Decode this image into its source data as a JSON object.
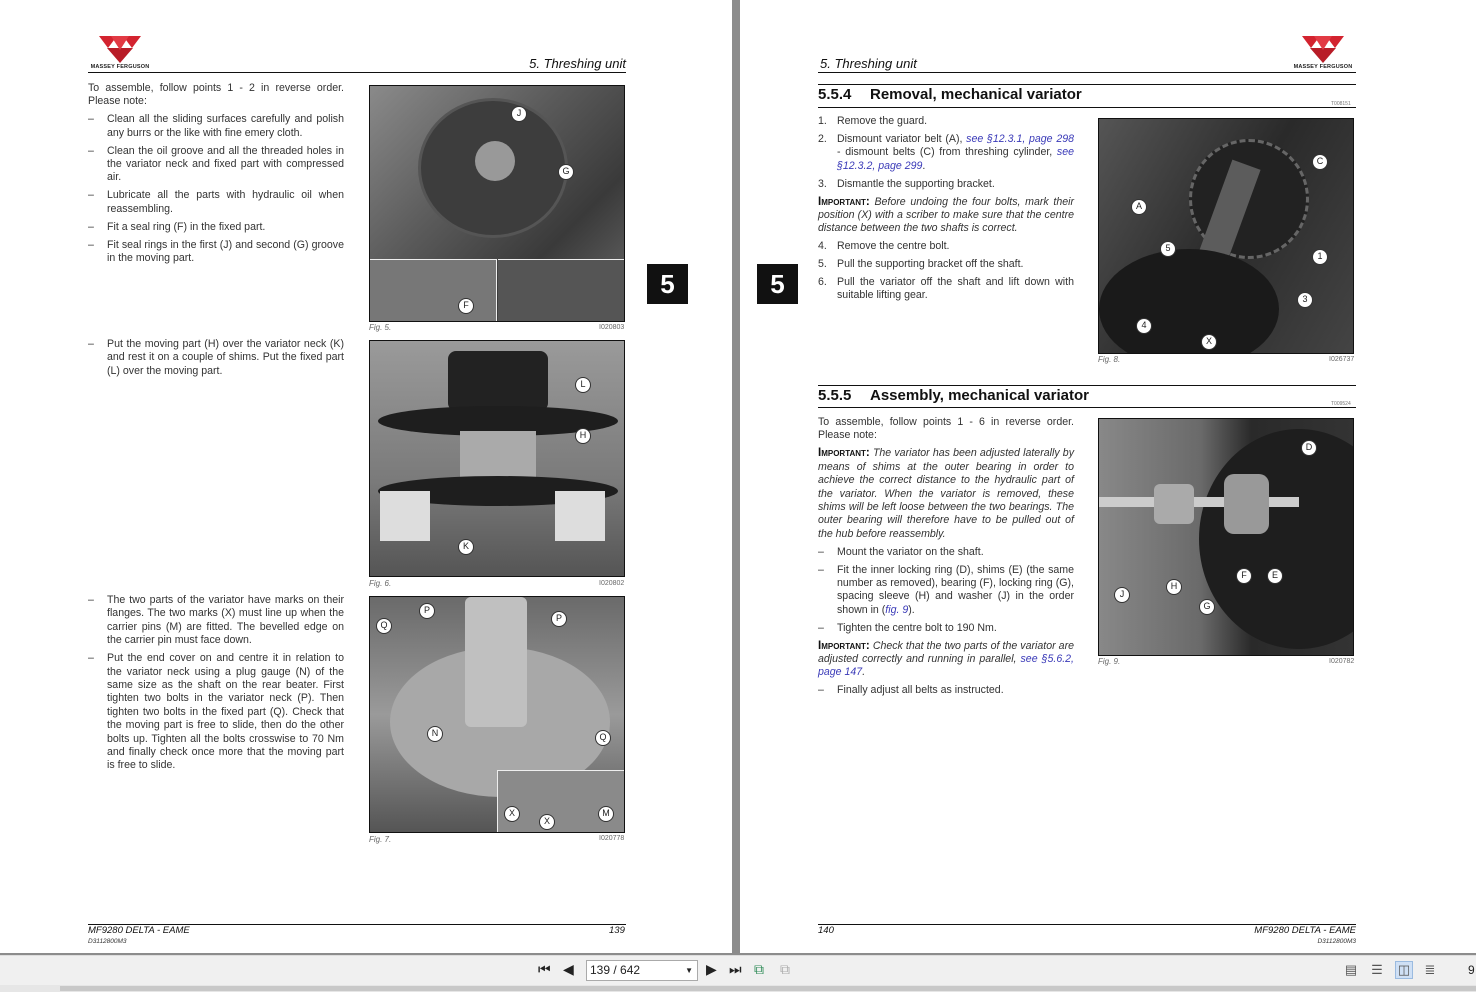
{
  "brand": "MASSEY FERGUSON",
  "colors": {
    "logo_red": "#d3232f",
    "link": "#3a3ab8",
    "tab": "#111111"
  },
  "left_page": {
    "header": "5. Threshing unit",
    "intro": "To assemble, follow points 1 - 2 in reverse order. Please note:",
    "bullets_a": [
      "Clean all the sliding surfaces carefully and polish any burrs or the like with fine emery cloth.",
      "Clean the oil groove and all the threaded holes in the variator neck and fixed part with compressed air.",
      "Lubricate all the parts with hydraulic oil when reassembling.",
      "Fit a seal ring (F) in the fixed part.",
      "Fit seal rings in the first (J) and second (G) groove in the moving part."
    ],
    "bullets_b": [
      "Put the moving part (H) over the variator neck (K) and rest it on a couple of shims. Put the fixed part (L) over the moving part."
    ],
    "bullets_c": [
      "The two parts of the variator have marks on their flanges. The two marks (X) must line up when the carrier pins (M) are fitted. The bevelled edge on the carrier pin must face down.",
      "Put the end cover on and centre it in relation to the variator neck using a plug gauge (N) of the same size as the shaft on the rear beater. First tighten two bolts in the variator neck (P). Then tighten two bolts in the fixed part (Q). Check that the moving part is free to slide, then do the other bolts up. Tighten all the bolts crosswise to 70 Nm and finally check once more that the moving part is free to slide."
    ],
    "bullet_mark": "–",
    "figs": [
      {
        "caption": "Fig. 5.",
        "id": "I020803",
        "callouts": [
          "J",
          "G",
          "F"
        ]
      },
      {
        "caption": "Fig. 6.",
        "id": "I020802",
        "callouts": [
          "L",
          "H",
          "K"
        ]
      },
      {
        "caption": "Fig. 7.",
        "id": "I020778",
        "callouts": [
          "P",
          "P",
          "Q",
          "N",
          "Q",
          "X",
          "X",
          "M"
        ]
      }
    ],
    "tab": "5",
    "footer_model": "MF9280 DELTA - EAME",
    "footer_doc": "D3112800M3",
    "page_num": "139"
  },
  "right_page": {
    "header": "5. Threshing unit",
    "tab": "5",
    "s554": {
      "num": "5.5.4",
      "title": "Removal, mechanical variator",
      "code": "T008151",
      "steps": [
        {
          "n": "1.",
          "t": "Remove the guard."
        },
        {
          "n": "2.",
          "t": "Dismount variator belt (A), ",
          "l1": "see §12.3.1, page 298",
          "t2": " - dismount belts (C) from threshing cylinder, ",
          "l2": "see §12.3.2, page 299",
          "t3": "."
        },
        {
          "n": "3.",
          "t": "Dismantle the supporting bracket."
        }
      ],
      "important_label": "Important:",
      "important": " Before undoing the four bolts, mark their position (X) with a scriber to make sure that the centre distance between the two shafts is correct.",
      "steps2": [
        {
          "n": "4.",
          "t": "Remove the centre bolt."
        },
        {
          "n": "5.",
          "t": "Pull the supporting bracket off the shaft."
        },
        {
          "n": "6.",
          "t": "Pull the variator off the shaft and lift down with suitable lifting gear."
        }
      ],
      "fig": {
        "caption": "Fig. 8.",
        "id": "I026737",
        "callouts": [
          "C",
          "A",
          "5",
          "1",
          "3",
          "4",
          "X"
        ]
      }
    },
    "s555": {
      "num": "5.5.5",
      "title": "Assembly, mechanical variator",
      "code": "T009524",
      "intro": "To assemble, follow points 1 - 6 in reverse order. Please note:",
      "important_label": "Important:",
      "important": " The variator has been adjusted laterally by means of shims at the outer bearing in order to achieve the correct distance to the hydraulic part of the variator. When the variator is removed, these shims will be left loose between the two bearings. The outer bearing will therefore have to be pulled out of the hub before reassembly.",
      "b1": "Mount the variator on the shaft.",
      "b2": "Fit the inner locking ring (D), shims (E) (the same number as removed), bearing (F), locking ring (G), spacing sleeve (H) and washer (J) in the order shown in (",
      "b2link": "fig. 9",
      "b2end": ").",
      "b3": "Tighten the centre bolt to 190 Nm.",
      "important2_label": "Important:",
      "important2": " Check that the two parts of the variator are adjusted correctly and running in parallel, ",
      "important2_link": "see §5.6.2, page 147",
      "important2_end": ".",
      "b4": "Finally adjust all belts as instructed.",
      "fig": {
        "caption": "Fig. 9.",
        "id": "I020782",
        "callouts": [
          "D",
          "F",
          "E",
          "J",
          "H",
          "G"
        ]
      }
    },
    "footer_model": "MF9280 DELTA - EAME",
    "footer_doc": "D3112800M3",
    "page_num": "140"
  },
  "toolbar": {
    "page_field": "139 / 642",
    "zoom_partial": "9"
  }
}
